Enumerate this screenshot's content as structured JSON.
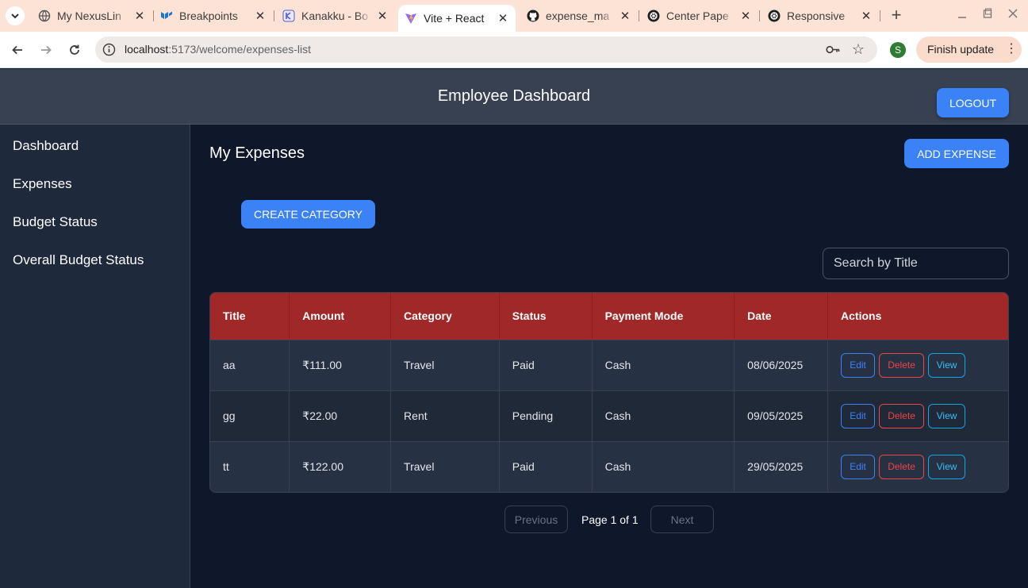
{
  "browser": {
    "tabs": [
      {
        "title": "My NexusLin",
        "icon": "globe-icon"
      },
      {
        "title": "Breakpoints",
        "icon": "mui-icon"
      },
      {
        "title": "Kanakku - Bo",
        "icon": "kanakku-icon"
      },
      {
        "title": "Vite + React",
        "icon": "vite-icon",
        "active": true
      },
      {
        "title": "expense_ma",
        "icon": "github-icon"
      },
      {
        "title": "Center Pape",
        "icon": "openai-icon"
      },
      {
        "title": "Responsive",
        "icon": "openai-icon"
      }
    ],
    "url_host": "localhost",
    "url_path": ":5173/welcome/expenses-list",
    "profile_initial": "S",
    "update_label": "Finish update"
  },
  "app": {
    "title": "Employee Dashboard",
    "logout_label": "LOGOUT"
  },
  "sidebar": {
    "items": [
      {
        "label": "Dashboard"
      },
      {
        "label": "Expenses"
      },
      {
        "label": "Budget Status"
      },
      {
        "label": "Overall Budget Status"
      }
    ]
  },
  "main": {
    "title": "My Expenses",
    "add_label": "ADD EXPENSE",
    "create_category_label": "CREATE CATEGORY",
    "search_placeholder": "Search by Title",
    "table": {
      "headers": [
        "Title",
        "Amount",
        "Category",
        "Status",
        "Payment Mode",
        "Date",
        "Actions"
      ],
      "rows": [
        {
          "title": "aa",
          "amount": "₹111.00",
          "category": "Travel",
          "status": "Paid",
          "payment_mode": "Cash",
          "date": "08/06/2025"
        },
        {
          "title": "gg",
          "amount": "₹22.00",
          "category": "Rent",
          "status": "Pending",
          "payment_mode": "Cash",
          "date": "09/05/2025"
        },
        {
          "title": "tt",
          "amount": "₹122.00",
          "category": "Travel",
          "status": "Paid",
          "payment_mode": "Cash",
          "date": "29/05/2025"
        }
      ],
      "actions": {
        "edit": "Edit",
        "delete": "Delete",
        "view": "View"
      }
    },
    "pagination": {
      "previous": "Previous",
      "page_info": "Page 1 of 1",
      "next": "Next"
    }
  },
  "colors": {
    "accent": "#3b82f6",
    "table_header": "#a12828",
    "danger": "#ef4444",
    "header_bg": "#374151",
    "sidebar_bg": "#1e293b",
    "main_bg": "#0f172a"
  }
}
